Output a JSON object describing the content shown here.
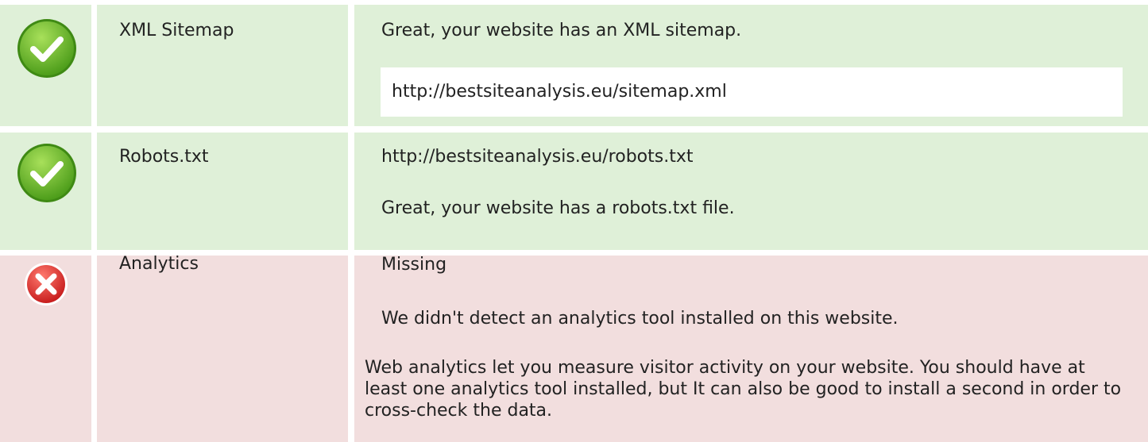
{
  "colors": {
    "pass_bg": "#dff0d8",
    "fail_bg": "#f2dede",
    "pass_icon": "#6cbf2a",
    "fail_icon": "#e2312f"
  },
  "rows": [
    {
      "status": "pass",
      "status_icon": "check-icon",
      "label": "XML Sitemap",
      "message": "Great, your website has an XML sitemap.",
      "url": "http://bestsiteanalysis.eu/sitemap.xml"
    },
    {
      "status": "pass",
      "status_icon": "check-icon",
      "label": "Robots.txt",
      "url": "http://bestsiteanalysis.eu/robots.txt",
      "message": "Great, your website has a robots.txt file."
    },
    {
      "status": "fail",
      "status_icon": "error-icon",
      "label": "Analytics",
      "result": "Missing",
      "message": "We didn't detect an analytics tool installed on this website.",
      "advice": "Web analytics let you measure visitor activity on your website. You should have at least one analytics tool installed, but It can also be good to install a second in order to cross-check the data."
    }
  ]
}
